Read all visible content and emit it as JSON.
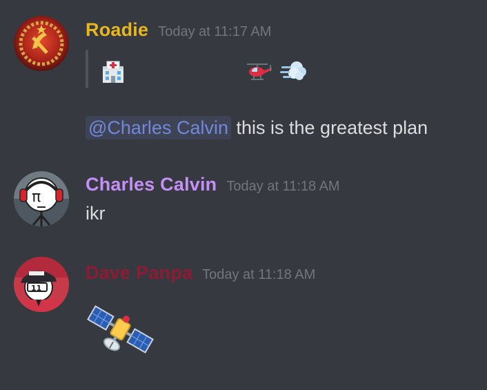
{
  "messages": [
    {
      "username": "Roadie",
      "username_color": "#e8b71c",
      "timestamp": "Today at 11:17 AM",
      "quote_emojis": [
        "hospital-emoji",
        "helicopter-emoji",
        "dash-emoji"
      ],
      "mention": "@Charles Calvin",
      "text": "this is the greatest plan"
    },
    {
      "username": "Charles Calvin",
      "username_color": "#c490f5",
      "timestamp": "Today at 11:18 AM",
      "text": "ikr"
    },
    {
      "username": "Dave Panpa",
      "username_color": "#8e1b33",
      "timestamp": "Today at 11:18 AM",
      "emoji": "satellite-emoji"
    }
  ]
}
